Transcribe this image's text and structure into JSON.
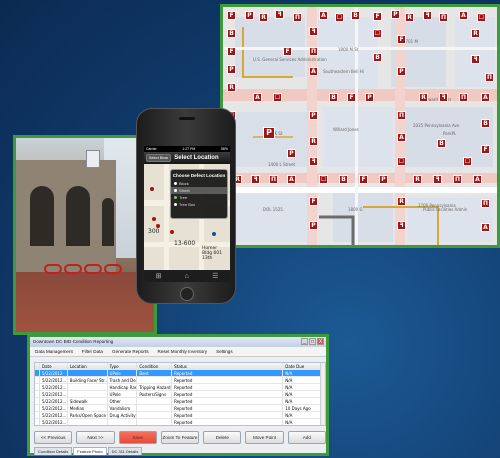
{
  "map": {
    "labels": [
      "U.S. General Services Administration",
      "1900 M St",
      "1701 M",
      "1666 K St",
      "Edward Porter",
      "ParkPL",
      "2025 Pennsylvania Ave",
      "DOL 1525",
      "1800 G",
      "1700 Pennsylvania",
      "Southeastern Bell Hi",
      "Willard Jones",
      "1400 L Street",
      "Public Facilities Admin"
    ],
    "marker_glyphs": [
      "F",
      "P",
      "Ŕ",
      "ꟻ",
      "Π",
      "A",
      "☐",
      "B"
    ],
    "marker_color": "#a31515"
  },
  "phone": {
    "status_left": "Carrier",
    "status_time": "1:27 PM",
    "status_right": "58%",
    "back_label": "Select Block",
    "title": "Select Location",
    "popup_title": "Choose Defect Location",
    "options": [
      {
        "label": "Block",
        "selected": false
      },
      {
        "label": "Street",
        "selected": true
      },
      {
        "label": "Tree",
        "selected": false
      },
      {
        "label": "Tree Box",
        "selected": false
      }
    ],
    "map_texts": [
      "13-600",
      "300",
      "Homer Bldg 601 13th"
    ],
    "toolbar_icons": [
      "grid-icon",
      "home-icon",
      "list-icon"
    ]
  },
  "app": {
    "title": "Downtown DC BID Condition Reporting",
    "window_controls": [
      "_",
      "□",
      "X"
    ],
    "menu": [
      "Data Management",
      "Filter Data",
      "Generate Reports",
      "Reset Monthly Inventory",
      "Settings"
    ],
    "columns": [
      "Date",
      "Location",
      "Type",
      "Condition",
      "Status",
      "Date Due"
    ],
    "rows": [
      {
        "date": "5/22/2012",
        "location": "",
        "type": "UPole",
        "condition": "Bent",
        "status": "Reported",
        "due": "N/A"
      },
      {
        "date": "5/22/2012...",
        "location": "Building Face/ Str...",
        "type": "Trash and Debris",
        "condition": "",
        "status": "Reported",
        "due": "N/A"
      },
      {
        "date": "5/22/2012...",
        "location": "",
        "type": "Handicap Ramp",
        "condition": "Tripping Hazard",
        "status": "Reported",
        "due": "N/A"
      },
      {
        "date": "5/22/2012...",
        "location": "",
        "type": "UPole",
        "condition": "Posters/Signs",
        "status": "Reported",
        "due": "N/A"
      },
      {
        "date": "5/22/2012...",
        "location": "Sidewalk",
        "type": "Other",
        "condition": "",
        "status": "Reported",
        "due": "N/A"
      },
      {
        "date": "5/22/2012...",
        "location": "Median",
        "type": "Vandalism",
        "condition": "",
        "status": "Reported",
        "due": "10 Days Ago"
      },
      {
        "date": "5/22/2012...",
        "location": "Parks/Open Space",
        "type": "Drug Activity",
        "condition": "",
        "status": "Reported",
        "due": "N/A"
      },
      {
        "date": "5/22/2012...",
        "location": "",
        "type": "",
        "condition": "",
        "status": "Reported",
        "due": "N/A"
      }
    ],
    "buttons": [
      "<< Previous",
      "Next >>",
      "Save",
      "Zoom To Feature",
      "Delete",
      "Move Point",
      "Add"
    ],
    "tabs": [
      "Condition Details",
      "Feature Photo",
      "DC 311 Details"
    ],
    "active_tab": 1,
    "accent_color": "#3399ff",
    "frame_color": "#3d9a3d"
  }
}
